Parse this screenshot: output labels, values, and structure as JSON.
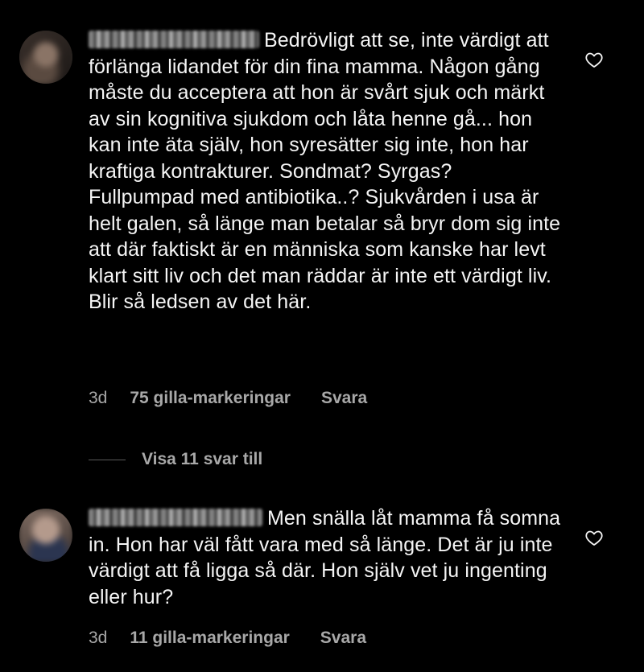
{
  "comments": [
    {
      "text": "Bedrövligt att se, inte värdigt att förlänga lidandet för din fina mamma. Någon gång måste du acceptera att hon är svårt sjuk och märkt av sin kognitiva sjukdom och låta henne gå... hon kan inte äta själv, hon syresätter sig inte, hon har kraftiga kontrakturer. Sondmat? Syrgas? Fullpumpad med antibiotika..? Sjukvården i usa är helt galen, så länge man betalar så bryr dom sig inte att där faktiskt är en människa som kanske har levt klart sitt liv och det man räddar är inte ett värdigt liv.  Blir så ledsen av det här.",
      "time": "3d",
      "likes": "75 gilla-markeringar",
      "reply": "Svara",
      "like_icon": "heart-outline-icon"
    },
    {
      "text": "Men snälla låt mamma få somna in. Hon har väl fått vara med så länge. Det är ju inte värdigt att få ligga så där. Hon själv vet ju ingenting eller hur?",
      "time": "3d",
      "likes": "11 gilla-markeringar",
      "reply": "Svara",
      "like_icon": "heart-outline-icon"
    }
  ],
  "view_more_replies": "Visa 11 svar till",
  "colors": {
    "background": "#000000",
    "text": "#f5f5f5",
    "secondary_text": "#a8a8a8"
  }
}
